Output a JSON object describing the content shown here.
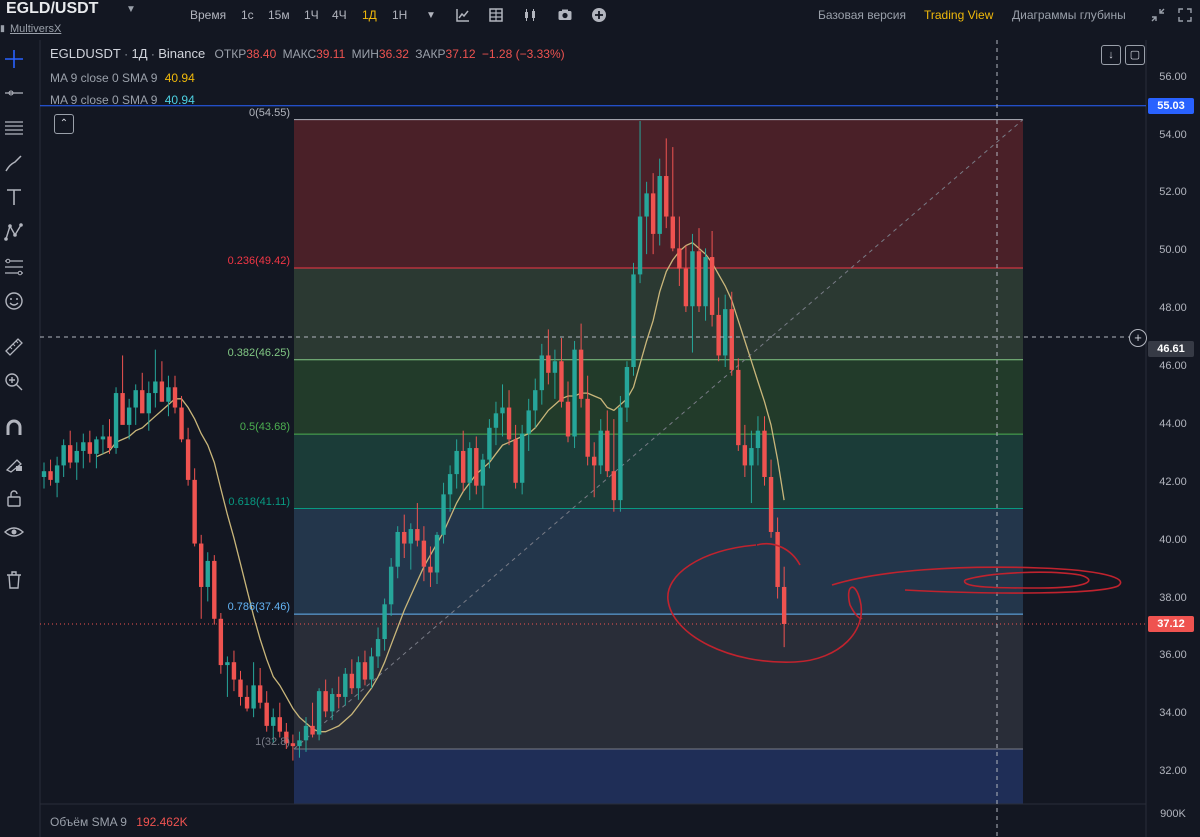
{
  "header": {
    "pair": "EGLD/USDT",
    "project": "MultiversX",
    "timeframes": [
      "Время",
      "1с",
      "15м",
      "1Ч",
      "4Ч",
      "1Д",
      "1Н"
    ],
    "active_timeframe": "1Д",
    "views": [
      "Базовая версия",
      "Trading View",
      "Диаграммы глубины"
    ],
    "active_view": "Trading View"
  },
  "legend": {
    "symbol": "EGLDUSDT",
    "interval": "1Д",
    "exchange": "Binance",
    "open_label": "ОТКР",
    "open": "38.40",
    "high_label": "МАКС",
    "high": "39.11",
    "low_label": "МИН",
    "low": "36.32",
    "close_label": "ЗАКР",
    "close": "37.12",
    "change": "−1.28 (−3.33%)",
    "ma1_label": "MA 9 close 0 SMA 9",
    "ma1_value": "40.94",
    "ma2_label": "MA 9 close 0 SMA 9",
    "ma2_value": "40.94",
    "volume_label": "Объём SMA 9",
    "volume_value": "192.462K"
  },
  "price_axis": [
    "56.00",
    "54.00",
    "52.00",
    "50.00",
    "48.00",
    "46.00",
    "44.00",
    "42.00",
    "40.00",
    "38.00",
    "36.00",
    "34.00",
    "32.00"
  ],
  "volume_axis": "900K",
  "price_tags": {
    "line": "55.03",
    "crosshair": "46.61",
    "last": "37.12"
  },
  "fib_levels": [
    {
      "label": "0(54.55)",
      "price": 54.55,
      "color": "#b2b5be",
      "fill": "rgba(120,40,46,0.55)"
    },
    {
      "label": "0.236(49.42)",
      "price": 49.42,
      "color": "#f23645",
      "fill": "rgba(52,70,56,0.75)"
    },
    {
      "label": "0.382(46.25)",
      "price": 46.25,
      "color": "#81c784",
      "fill": "rgba(40,72,46,0.75)"
    },
    {
      "label": "0.5(43.68)",
      "price": 43.68,
      "color": "#4caf50",
      "fill": "rgba(30,70,62,0.8)"
    },
    {
      "label": "0.618(41.11)",
      "price": 41.11,
      "color": "#089981",
      "fill": "rgba(40,62,86,0.8)"
    },
    {
      "label": "0.786(37.46)",
      "price": 37.46,
      "color": "#64b5f6",
      "fill": "rgba(50,54,64,0.75)"
    },
    {
      "label": "1(32.8)",
      "price": 32.8,
      "color": "#787b86",
      "fill": "rgba(34,50,96,0.85)"
    }
  ],
  "colors": {
    "up": "#26a69a",
    "down": "#ef5350",
    "accent": "#f0b90b",
    "ma": "#c9b67a",
    "blue_line": "#2962ff",
    "annotation": "#c0232e"
  },
  "chart_data": {
    "type": "candlestick",
    "ylim": [
      30.9,
      57.3
    ],
    "series": [
      {
        "name": "EGLDUSDT",
        "ohlc": [
          [
            42.2,
            42.7,
            41.8,
            42.4
          ],
          [
            42.4,
            42.8,
            41.9,
            42.1
          ],
          [
            42.0,
            42.9,
            41.5,
            42.6
          ],
          [
            42.6,
            43.5,
            42.2,
            43.3
          ],
          [
            43.3,
            43.8,
            42.5,
            42.7
          ],
          [
            42.7,
            43.4,
            42.1,
            43.1
          ],
          [
            43.1,
            43.7,
            42.5,
            43.4
          ],
          [
            43.4,
            43.8,
            42.7,
            43.0
          ],
          [
            43.0,
            43.6,
            42.5,
            43.5
          ],
          [
            43.5,
            44.0,
            43.0,
            43.6
          ],
          [
            43.6,
            44.2,
            43.0,
            43.2
          ],
          [
            43.2,
            45.3,
            43.0,
            45.1
          ],
          [
            45.1,
            46.4,
            44.6,
            44.0
          ],
          [
            44.0,
            44.9,
            43.5,
            44.6
          ],
          [
            44.6,
            45.4,
            44.0,
            45.2
          ],
          [
            45.2,
            45.8,
            44.5,
            44.4
          ],
          [
            44.4,
            45.5,
            43.8,
            45.1
          ],
          [
            45.1,
            46.6,
            44.6,
            45.5
          ],
          [
            45.5,
            46.2,
            44.8,
            44.8
          ],
          [
            44.8,
            45.7,
            44.3,
            45.3
          ],
          [
            45.3,
            45.7,
            44.4,
            44.6
          ],
          [
            44.6,
            45.0,
            43.4,
            43.5
          ],
          [
            43.5,
            43.9,
            41.9,
            42.1
          ],
          [
            42.1,
            42.5,
            39.8,
            39.9
          ],
          [
            39.9,
            40.2,
            37.3,
            38.4
          ],
          [
            38.4,
            39.6,
            37.9,
            39.3
          ],
          [
            39.3,
            39.5,
            37.1,
            37.3
          ],
          [
            37.3,
            37.5,
            35.4,
            35.7
          ],
          [
            35.7,
            36.0,
            34.6,
            35.8
          ],
          [
            35.8,
            36.2,
            34.8,
            35.2
          ],
          [
            35.2,
            35.5,
            34.3,
            34.6
          ],
          [
            34.6,
            35.0,
            34.1,
            34.2
          ],
          [
            34.2,
            35.8,
            33.9,
            35.0
          ],
          [
            35.0,
            35.6,
            34.2,
            34.4
          ],
          [
            34.4,
            34.8,
            33.4,
            33.6
          ],
          [
            33.6,
            34.2,
            33.0,
            33.9
          ],
          [
            33.9,
            34.4,
            33.2,
            33.4
          ],
          [
            33.4,
            33.7,
            32.8,
            33.0
          ],
          [
            33.0,
            33.3,
            32.4,
            32.9
          ],
          [
            32.9,
            33.4,
            32.5,
            33.1
          ],
          [
            33.1,
            33.9,
            32.7,
            33.6
          ],
          [
            33.6,
            34.4,
            33.2,
            33.3
          ],
          [
            33.3,
            34.9,
            33.1,
            34.8
          ],
          [
            34.8,
            35.2,
            33.9,
            34.1
          ],
          [
            34.1,
            34.9,
            33.8,
            34.7
          ],
          [
            34.7,
            35.3,
            34.2,
            34.6
          ],
          [
            34.6,
            35.6,
            34.3,
            35.4
          ],
          [
            35.4,
            35.9,
            34.7,
            34.9
          ],
          [
            34.9,
            36.0,
            34.5,
            35.8
          ],
          [
            35.8,
            36.2,
            35.0,
            35.2
          ],
          [
            35.2,
            36.3,
            34.9,
            36.0
          ],
          [
            36.0,
            37.0,
            35.6,
            36.6
          ],
          [
            36.6,
            38.0,
            36.2,
            37.8
          ],
          [
            37.8,
            39.4,
            37.4,
            39.1
          ],
          [
            39.1,
            40.5,
            38.7,
            40.3
          ],
          [
            40.3,
            40.9,
            39.4,
            39.9
          ],
          [
            39.9,
            40.6,
            39.0,
            40.4
          ],
          [
            40.4,
            41.3,
            39.8,
            40.0
          ],
          [
            40.0,
            40.5,
            38.6,
            39.1
          ],
          [
            39.1,
            39.8,
            38.4,
            38.9
          ],
          [
            38.9,
            40.3,
            38.5,
            40.2
          ],
          [
            40.2,
            42.0,
            39.9,
            41.6
          ],
          [
            41.6,
            42.6,
            41.0,
            42.3
          ],
          [
            42.3,
            43.5,
            41.8,
            43.1
          ],
          [
            43.1,
            43.8,
            41.7,
            42.0
          ],
          [
            42.0,
            43.4,
            41.4,
            43.2
          ],
          [
            43.2,
            43.6,
            41.6,
            41.9
          ],
          [
            41.9,
            43.0,
            41.1,
            42.8
          ],
          [
            42.8,
            44.2,
            42.5,
            43.9
          ],
          [
            43.9,
            44.8,
            43.3,
            44.4
          ],
          [
            44.4,
            45.4,
            43.6,
            44.6
          ],
          [
            44.6,
            45.2,
            43.3,
            43.5
          ],
          [
            43.5,
            44.0,
            41.8,
            42.0
          ],
          [
            42.0,
            44.0,
            41.6,
            43.7
          ],
          [
            43.7,
            44.9,
            43.1,
            44.5
          ],
          [
            44.5,
            45.6,
            43.9,
            45.2
          ],
          [
            45.2,
            46.8,
            44.7,
            46.4
          ],
          [
            46.4,
            47.3,
            45.4,
            45.8
          ],
          [
            45.8,
            46.6,
            44.9,
            46.2
          ],
          [
            46.2,
            47.0,
            44.6,
            44.8
          ],
          [
            44.8,
            45.5,
            43.4,
            43.6
          ],
          [
            43.6,
            46.9,
            43.2,
            46.6
          ],
          [
            46.6,
            47.5,
            44.6,
            44.9
          ],
          [
            44.9,
            45.7,
            42.6,
            42.9
          ],
          [
            42.9,
            43.4,
            41.5,
            42.6
          ],
          [
            42.6,
            44.2,
            42.3,
            43.8
          ],
          [
            43.8,
            44.5,
            42.2,
            42.4
          ],
          [
            42.4,
            44.2,
            41.0,
            41.4
          ],
          [
            41.4,
            45.0,
            41.0,
            44.6
          ],
          [
            44.6,
            46.2,
            44.1,
            46.0
          ],
          [
            46.0,
            49.6,
            45.7,
            49.2
          ],
          [
            49.2,
            54.5,
            48.9,
            51.2
          ],
          [
            51.2,
            52.4,
            49.9,
            52.0
          ],
          [
            52.0,
            52.7,
            49.9,
            50.6
          ],
          [
            50.6,
            53.2,
            50.2,
            52.6
          ],
          [
            52.6,
            53.9,
            50.8,
            51.2
          ],
          [
            51.2,
            53.6,
            50.0,
            50.1
          ],
          [
            50.1,
            51.2,
            48.8,
            49.4
          ],
          [
            49.4,
            50.2,
            47.9,
            48.1
          ],
          [
            48.1,
            50.6,
            46.5,
            50.0
          ],
          [
            50.0,
            50.8,
            47.9,
            48.1
          ],
          [
            48.1,
            50.1,
            47.6,
            49.8
          ],
          [
            49.8,
            50.7,
            47.4,
            47.8
          ],
          [
            47.8,
            48.4,
            46.2,
            46.4
          ],
          [
            46.4,
            48.5,
            46.0,
            48.0
          ],
          [
            48.0,
            48.6,
            45.7,
            45.9
          ],
          [
            45.9,
            46.3,
            43.1,
            43.3
          ],
          [
            43.3,
            44.0,
            42.2,
            42.6
          ],
          [
            42.6,
            43.8,
            41.3,
            43.2
          ],
          [
            43.2,
            44.3,
            42.6,
            43.8
          ],
          [
            43.8,
            44.3,
            41.9,
            42.2
          ],
          [
            42.2,
            42.8,
            40.1,
            40.3
          ],
          [
            40.3,
            40.8,
            38.0,
            38.4
          ],
          [
            38.4,
            39.1,
            36.32,
            37.12
          ]
        ]
      },
      {
        "name": "MA 9 close 0 SMA 9",
        "values": [
          null,
          null,
          null,
          null,
          null,
          null,
          null,
          null,
          42.9,
          43.0,
          43.1,
          43.4,
          43.5,
          43.6,
          43.8,
          43.9,
          44.1,
          44.3,
          44.5,
          44.7,
          44.9,
          44.9,
          44.6,
          44.2,
          43.7,
          43.3,
          42.7,
          41.8,
          40.9,
          40.1,
          39.2,
          38.3,
          37.4,
          36.6,
          35.9,
          35.3,
          35.0,
          34.6,
          34.2,
          33.9,
          33.7,
          33.5,
          33.4,
          33.4,
          33.5,
          33.6,
          33.8,
          34.0,
          34.3,
          34.6,
          34.9,
          35.3,
          35.8,
          36.4,
          37.0,
          37.6,
          38.1,
          38.6,
          39.1,
          39.5,
          39.9,
          40.3,
          40.8,
          41.3,
          41.7,
          42.0,
          42.3,
          42.5,
          42.7,
          43.0,
          43.3,
          43.4,
          43.5,
          43.6,
          43.7,
          43.9,
          44.2,
          44.5,
          44.7,
          44.9,
          45.0,
          45.0,
          45.1,
          45.1,
          45.0,
          44.9,
          44.6,
          44.5,
          44.7,
          44.9,
          45.3,
          46.1,
          46.9,
          47.6,
          48.6,
          49.3,
          49.7,
          50.0,
          50.2,
          50.3,
          50.1,
          49.9,
          49.6,
          49.2,
          48.8,
          48.3,
          47.6,
          46.9,
          46.2,
          45.5,
          44.8,
          44.0,
          42.8,
          41.4
        ]
      }
    ]
  }
}
